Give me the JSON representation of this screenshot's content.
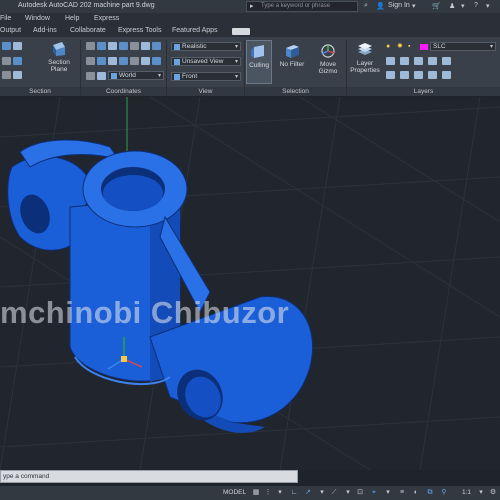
{
  "titlebar": {
    "title": "Autodesk AutoCAD 202    machine part 9.dwg",
    "search_placeholder": "Type a keyword or phrase",
    "sign_in": "Sign In"
  },
  "menu_tabs": [
    "File",
    "Window",
    "Help",
    "Express"
  ],
  "ribbon_tabs": [
    {
      "label": "Output",
      "active": false
    },
    {
      "label": "Add-ins",
      "active": false
    },
    {
      "label": "Collaborate",
      "active": false
    },
    {
      "label": "Express Tools",
      "active": false
    },
    {
      "label": "Featured Apps",
      "active": false
    }
  ],
  "ribbon": {
    "section_plane_label": "Section\nPlane",
    "coordinates_dropdown": "World",
    "views_dropdown_1": "Realistic",
    "views_dropdown_2": "Unsaved View",
    "views_dropdown_3": "Front",
    "culling_label": "Culling",
    "nofilter_label": "No Filter",
    "move_gizmo_label": "Move\nGizmo",
    "layer_properties_label": "Layer\nProperties",
    "layer_dropdown": "SLC",
    "panels": [
      "Section",
      "Coordinates",
      "View",
      "Selection",
      "Layers"
    ]
  },
  "watermark": "mchinobi Chibuzor",
  "command_line": "ype a command",
  "statusbar": {
    "model_label": "MODEL",
    "scale": "1:1"
  },
  "colors": {
    "model_fill": "#1a5fd8",
    "model_edge": "#0d2f78",
    "accent": "#5fa2e8",
    "layer_swatch": "#ff1aff"
  }
}
